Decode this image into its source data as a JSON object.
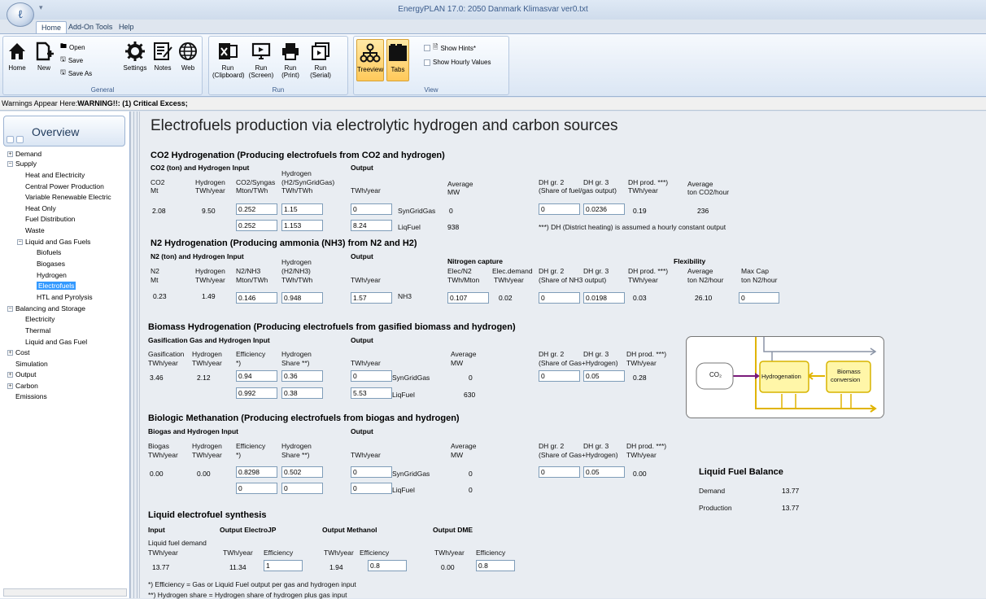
{
  "window": {
    "title": "EnergyPLAN 17.0:  2050 Danmark Klimasvar ver0.txt",
    "logo": "ℓ"
  },
  "tabs": {
    "home": "Home",
    "addon": "Add-On Tools",
    "help": "Help"
  },
  "ribbon": {
    "general": {
      "label": "General",
      "home": "Home",
      "new": "New",
      "open": "Open",
      "save": "Save",
      "saveas": "Save As",
      "settings": "Settings",
      "notes": "Notes",
      "web": "Web"
    },
    "run": {
      "label": "Run",
      "clip1": "Run",
      "clip2": "(Clipboard)",
      "screen1": "Run",
      "screen2": "(Screen)",
      "print1": "Run",
      "print2": "(Print)",
      "serial1": "Run",
      "serial2": "(Serial)"
    },
    "view": {
      "label": "View",
      "treeview": "Treeview",
      "tabs": "Tabs",
      "hints": "Show Hints*",
      "hourly": "Show Hourly Values"
    }
  },
  "warning": {
    "prefix": "Warnings Appear Here:",
    "text": "WARNING!!: (1) Critical Excess;"
  },
  "sidebar": {
    "title": "Overview",
    "items": {
      "demand": "Demand",
      "supply": "Supply",
      "heat_elec": "Heat and Electricity",
      "cpp": "Central Power Production",
      "vre": "Variable Renewable Electric",
      "heat_only": "Heat Only",
      "fuel_dist": "Fuel Distribution",
      "waste": "Waste",
      "liq_gas": "Liquid and Gas Fuels",
      "biofuels": "Biofuels",
      "biogases": "Biogases",
      "hydrogen": "Hydrogen",
      "electrofuels": "Electrofuels",
      "htl": "HTL and Pyrolysis",
      "balancing": "Balancing and Storage",
      "electricity": "Electricity",
      "thermal": "Thermal",
      "liq_gas_fuel": "Liquid and Gas Fuel",
      "cost": "Cost",
      "simulation": "Simulation",
      "output": "Output",
      "carbon": "Carbon",
      "emissions": "Emissions"
    }
  },
  "page": {
    "title": "Electrofuels production via electrolytic hydrogen and carbon sources"
  },
  "co2": {
    "title": "CO2 Hydrogenation (Producing electrofuels from CO2 and hydrogen)",
    "input_head": "CO2 (ton) and Hydrogen Input",
    "output_head": "Output",
    "h_co2a": "CO2",
    "h_co2b": "Mt",
    "h_h2a": "Hydrogen",
    "h_h2b": "TWh/year",
    "h_syn0": "CO2/Syngas",
    "h_syna": "Mton/TWh",
    "h_hyd0": "Hydrogen",
    "h_hyda": "(H2/SynGridGas)",
    "h_hydb": "TWh/TWh",
    "h_out": "TWh/year",
    "h_ava": "Average",
    "h_avb": "MW",
    "h_dh2": "DH gr. 2",
    "h_dh3": "DH gr. 3",
    "h_share": "(Share of fuel/gas output)",
    "h_dhp": "DH prod. ***)",
    "h_dhpb": "TWh/year",
    "h_ava2": "Average",
    "h_avb2": "ton CO2/hour",
    "co2_val": "2.08",
    "h2_val": "9.50",
    "syn1": "0.252",
    "hyd1": "1.15",
    "out1": "0",
    "prod1": "SynGridGas",
    "avg1": "0",
    "dh2": "0",
    "dh3": "0.0236",
    "dhp": "0.19",
    "avgco2": "236",
    "syn2": "0.252",
    "hyd2": "1.153",
    "out2": "8.24",
    "prod2": "LiqFuel",
    "avg2": "938",
    "note": "***) DH (District heating) is assumed a hourly constant output"
  },
  "n2": {
    "title": "N2 Hydrogenation (Producing ammonia (NH3) from N2 and H2)",
    "input_head": "N2 (ton) and Hydrogen Input",
    "output_head": "Output",
    "nitro_head": "Nitrogen capture",
    "flex_head": "Flexibility",
    "h_n2a": "N2",
    "h_n2b": "Mt",
    "h_h2a": "Hydrogen",
    "h_h2b": "TWh/year",
    "h_nh3a": "N2/NH3",
    "h_nh3b": "Mton/TWh",
    "h_hyd0": "Hydrogen",
    "h_hyda": "(H2/NH3)",
    "h_hydb": "TWh/TWh",
    "h_out": "TWh/year",
    "h_eln2a": "Elec/N2",
    "h_eln2b": "TWh/Mton",
    "h_eda": "Elec.demand",
    "h_edb": "TWh/year",
    "h_dh2": "DH gr. 2",
    "h_dh3": "DH gr. 3",
    "h_share": "(Share of NH3 output)",
    "h_dhp": "DH prod. ***)",
    "h_dhpb": "TWh/year",
    "h_ava": "Average",
    "h_avb": "ton N2/hour",
    "h_mca": "Max Cap",
    "h_mcb": "ton N2/hour",
    "n2_val": "0.23",
    "h2_val": "1.49",
    "nh3": "0.146",
    "hyd": "0.948",
    "out": "1.57",
    "prod": "NH3",
    "eln2": "0.107",
    "ed": "0.02",
    "dh2": "0",
    "dh3": "0.0198",
    "dhp": "0.03",
    "avg": "26.10",
    "maxcap": "0"
  },
  "biomass": {
    "title": "Biomass Hydrogenation (Producing electrofuels from gasified biomass and hydrogen)",
    "input_head": "Gasification Gas and Hydrogen Input",
    "output_head": "Output",
    "h_gga": "Gasification",
    "h_ggb": "TWh/year",
    "h_h2a": "Hydrogen",
    "h_h2b": "TWh/year",
    "h_effa": "Efficiency",
    "h_effb": "*)",
    "h_hsa": "Hydrogen",
    "h_hsb": "Share **)",
    "h_out": "TWh/year",
    "h_ava": "Average",
    "h_avb": "MW",
    "h_dh2": "DH gr. 2",
    "h_dh3": "DH gr. 3",
    "h_share": "(Share of Gas+Hydrogen)",
    "h_dhp": "DH prod. ***)",
    "h_dhpb": "TWh/year",
    "gg": "3.46",
    "h2": "2.12",
    "eff1": "0.94",
    "hs1": "0.36",
    "out1": "0",
    "prod1": "SynGridGas",
    "avg1": "0",
    "dh2": "0",
    "dh3": "0.05",
    "dhp": "0.28",
    "eff2": "0.992",
    "hs2": "0.38",
    "out2": "5.53",
    "prod2": "LiqFuel",
    "avg2": "630"
  },
  "diagram": {
    "co2": "CO₂",
    "hydro": "Hydrogenation",
    "bio1": "Biomass",
    "bio2": "conversion"
  },
  "methan": {
    "title": "Biologic Methanation (Producing electrofuels from biogas and hydrogen)",
    "input_head": "Biogas and Hydrogen Input",
    "output_head": "Output",
    "h_bga": "Biogas",
    "h_bgb": "TWh/year",
    "h_h2a": "Hydrogen",
    "h_h2b": "TWh/year",
    "h_effa": "Efficiency",
    "h_effb": "*)",
    "h_hsa": "Hydrogen",
    "h_hsb": "Share **)",
    "h_out": "TWh/year",
    "h_ava": "Average",
    "h_avb": "MW",
    "h_dh2": "DH gr. 2",
    "h_dh3": "DH gr. 3",
    "h_share": "(Share of Gas+Hydrogen)",
    "h_dhp": "DH prod. ***)",
    "h_dhpb": "TWh/year",
    "bg": "0.00",
    "h2": "0.00",
    "eff1": "0.8298",
    "hs1": "0.502",
    "out1": "0",
    "prod1": "SynGridGas",
    "avg1": "0",
    "dh2": "0",
    "dh3": "0.05",
    "dhp": "0.00",
    "eff2": "0",
    "hs2": "0",
    "out2": "0",
    "prod2": "LiqFuel",
    "avg2": "0"
  },
  "lfb": {
    "title": "Liquid Fuel Balance",
    "demand_label": "Demand",
    "demand": "13.77",
    "prod_label": "Production",
    "prod": "13.77"
  },
  "synth": {
    "title": "Liquid electrofuel synthesis",
    "input_head": "Input",
    "jp_head": "Output ElectroJP",
    "meth_head": "Output Methanol",
    "dme_head": "Output DME",
    "h_lfd": "Liquid fuel demand",
    "h_in": "TWh/year",
    "h_jp": "TWh/year",
    "h_jpeff": "Efficiency",
    "h_me": "TWh/year",
    "h_meeff": "Efficiency",
    "h_dme": "TWh/year",
    "h_dmeeff": "Efficiency",
    "lfd": "13.77",
    "jp": "11.34",
    "jpeff": "1",
    "me": "1.94",
    "meeff": "0.8",
    "dme": "0.00",
    "dmeeff": "0.8"
  },
  "footnotes": {
    "f1": "*) Efficiency = Gas or Liquid Fuel output per gas and hydrogen input",
    "f2": "**) Hydrogen share = Hydrogen share of hydrogen plus gas input"
  }
}
